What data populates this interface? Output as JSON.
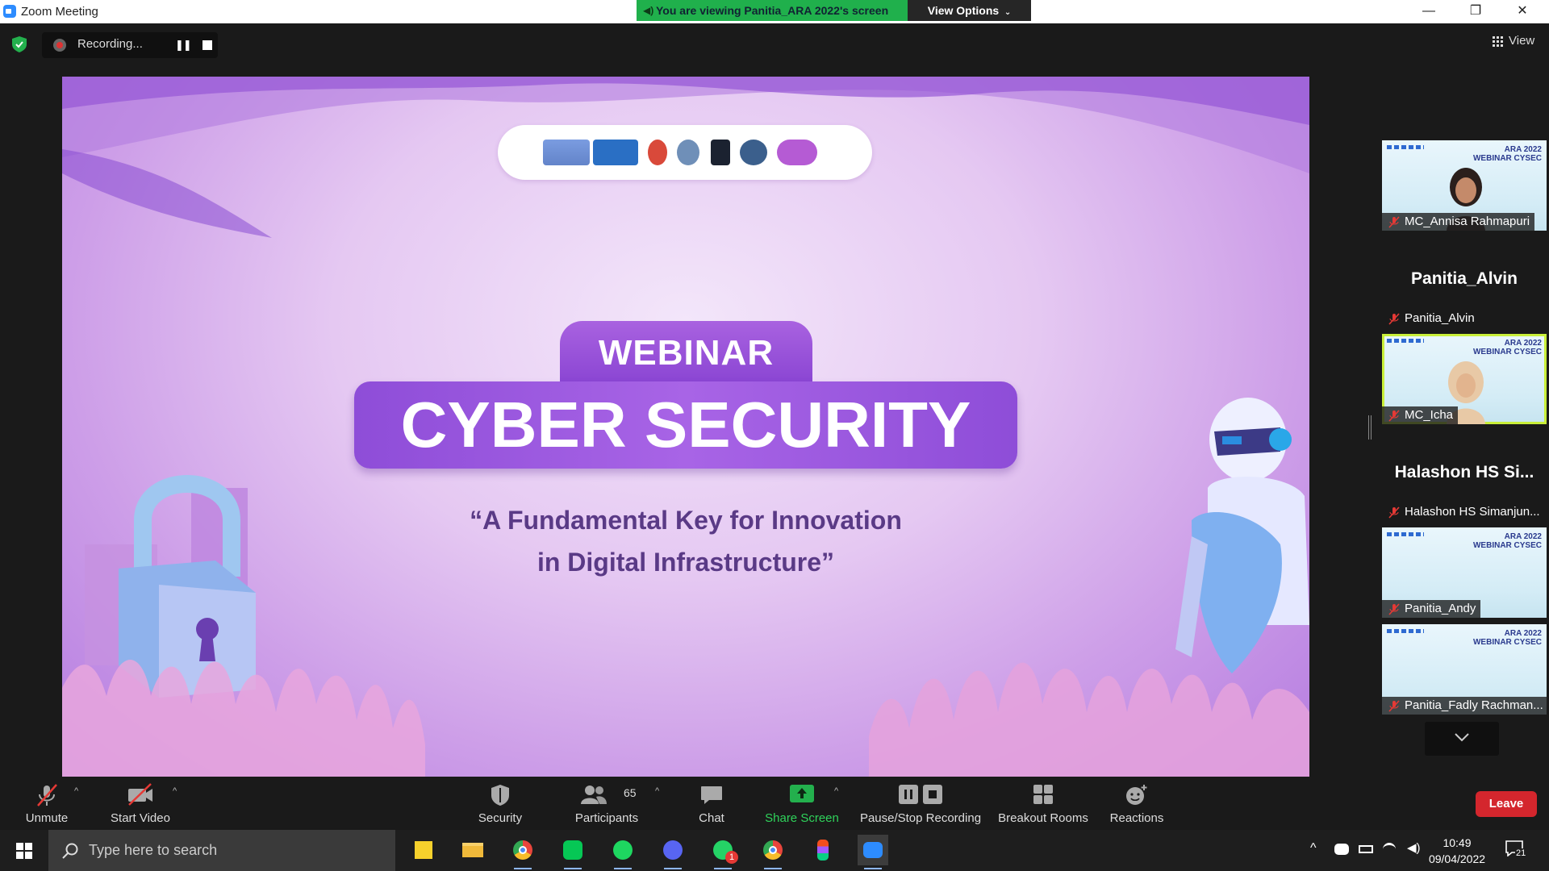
{
  "window": {
    "title": "Zoom Meeting",
    "share_banner": "You are viewing Panitia_ARA 2022's screen",
    "view_options": "View Options",
    "minimize": "—",
    "restore": "❐",
    "close": "✕"
  },
  "meeting_bar": {
    "recording_label": "Recording...",
    "view_label": "View"
  },
  "slide": {
    "tag": "WEBINAR",
    "title": "CYBER SECURITY",
    "subtitle_line1": "“A Fundamental Key for Innovation",
    "subtitle_line2": "in Digital Infrastructure”"
  },
  "gallery": {
    "ara_line1": "ARA 2022",
    "ara_line2": "WEBINAR CYSEC",
    "participants": [
      {
        "name": "MC_Annisa Rahmapuri",
        "video": true,
        "active": false
      },
      {
        "name": "Panitia_Alvin",
        "display": "Panitia_Alvin",
        "video": false,
        "active": false
      },
      {
        "name": "MC_Icha",
        "video": true,
        "active": true
      },
      {
        "name": "Halashon HS Simanjun...",
        "display": "Halashon HS Si...",
        "video": false,
        "active": false
      },
      {
        "name": "Panitia_Andy",
        "video": true,
        "active": false
      },
      {
        "name": "Panitia_Fadly Rachman...",
        "video": true,
        "active": false
      }
    ]
  },
  "toolbar": {
    "unmute": "Unmute",
    "start_video": "Start Video",
    "security": "Security",
    "participants": "Participants",
    "participants_count": "65",
    "chat": "Chat",
    "share_screen": "Share Screen",
    "pause_stop_recording": "Pause/Stop Recording",
    "breakout_rooms": "Breakout Rooms",
    "reactions": "Reactions",
    "leave": "Leave"
  },
  "taskbar": {
    "search_placeholder": "Type here to search",
    "time": "10:49",
    "date": "09/04/2022",
    "notification_count": "21",
    "whatsapp_badge": "1"
  },
  "colors": {
    "share_green": "#20b04c",
    "leave_red": "#d4262d",
    "active_speaker": "#c9ef39",
    "slide_purple": "#8e4dd8"
  }
}
